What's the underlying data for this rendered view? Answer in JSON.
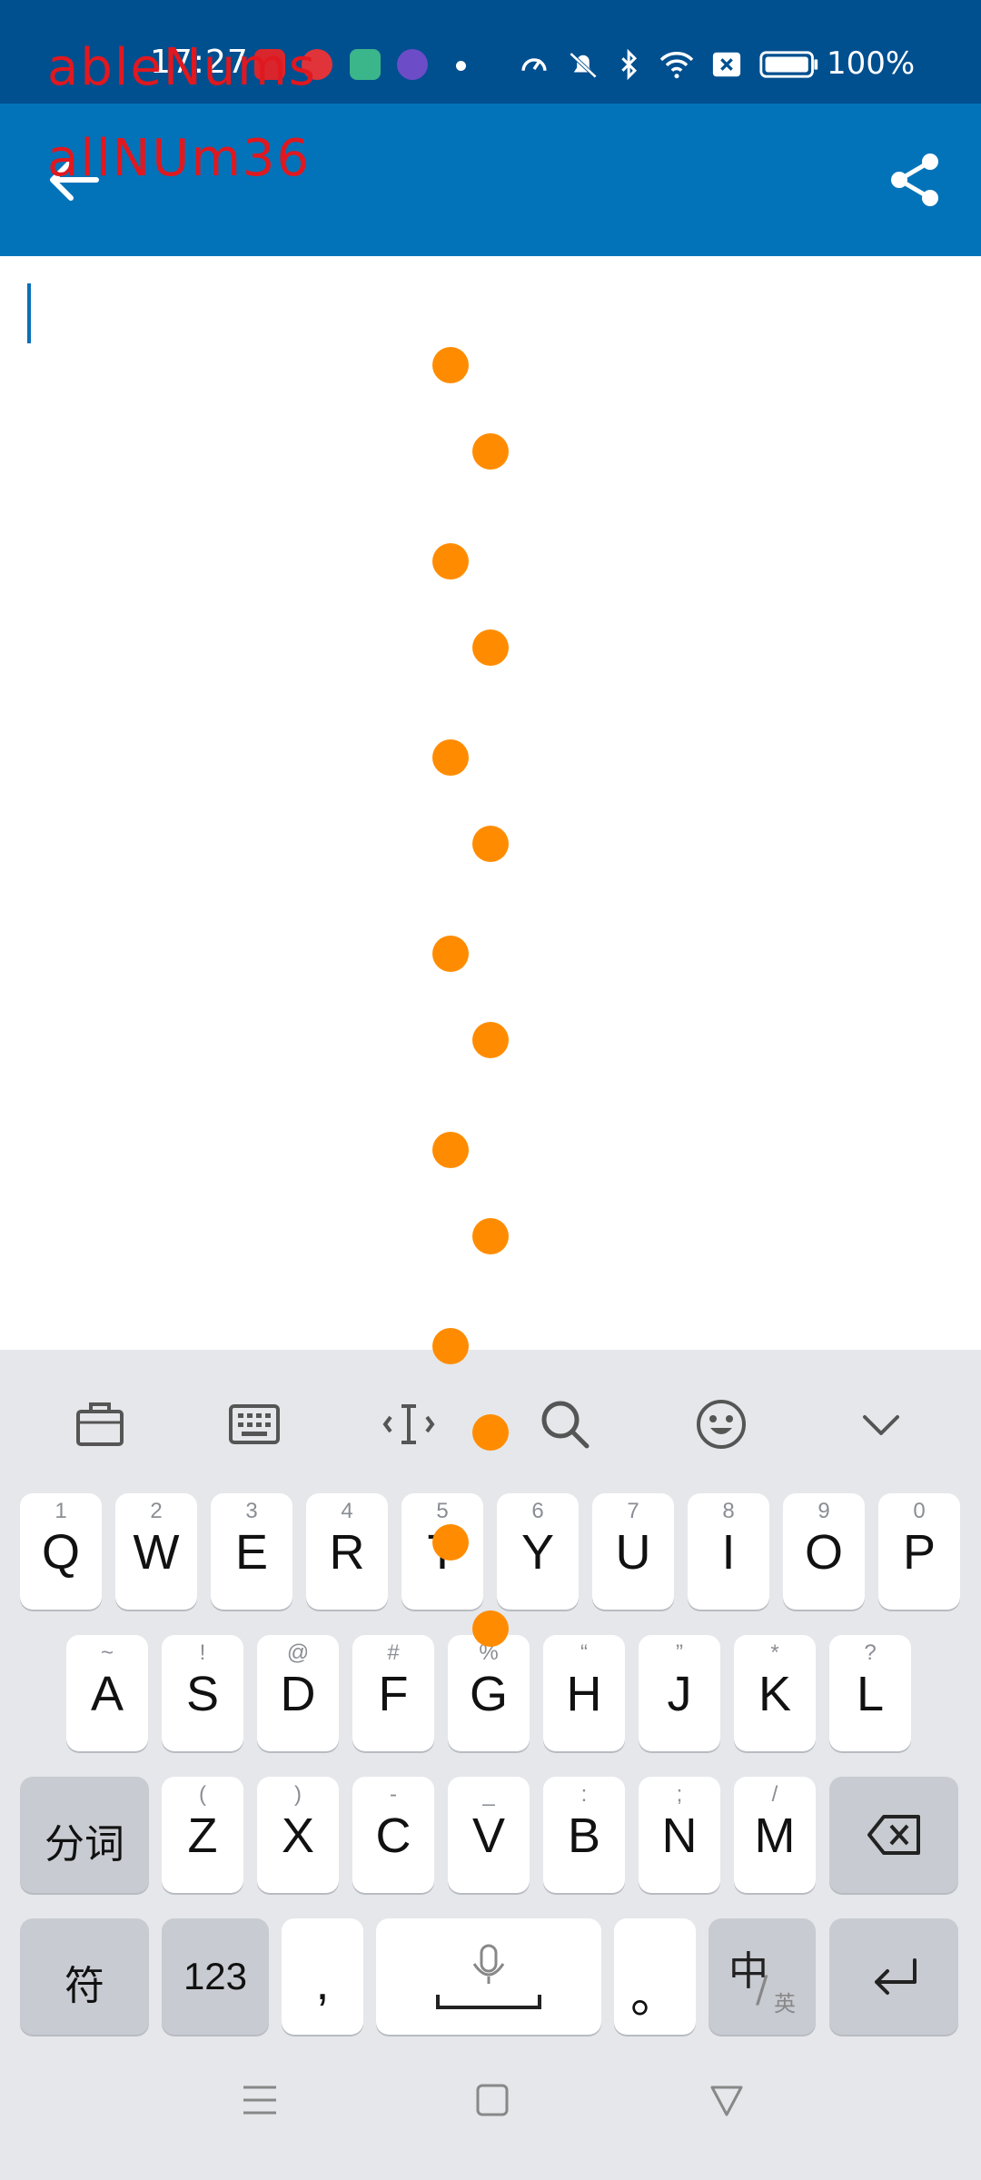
{
  "status_bar": {
    "time": "17:27",
    "battery": "100%"
  },
  "overlay": {
    "line1": "ableNums",
    "line2": "allNUm36"
  },
  "keyboard": {
    "row1": [
      {
        "label": "Q",
        "hint": "1"
      },
      {
        "label": "W",
        "hint": "2"
      },
      {
        "label": "E",
        "hint": "3"
      },
      {
        "label": "R",
        "hint": "4"
      },
      {
        "label": "T",
        "hint": "5"
      },
      {
        "label": "Y",
        "hint": "6"
      },
      {
        "label": "U",
        "hint": "7"
      },
      {
        "label": "I",
        "hint": "8"
      },
      {
        "label": "O",
        "hint": "9"
      },
      {
        "label": "P",
        "hint": "0"
      }
    ],
    "row2": [
      {
        "label": "A",
        "hint": "~"
      },
      {
        "label": "S",
        "hint": "!"
      },
      {
        "label": "D",
        "hint": "@"
      },
      {
        "label": "F",
        "hint": "#"
      },
      {
        "label": "G",
        "hint": "%"
      },
      {
        "label": "H",
        "hint": "“"
      },
      {
        "label": "J",
        "hint": "”"
      },
      {
        "label": "K",
        "hint": "*"
      },
      {
        "label": "L",
        "hint": "?"
      }
    ],
    "row3": [
      {
        "label": "Z",
        "hint": "("
      },
      {
        "label": "X",
        "hint": ")"
      },
      {
        "label": "C",
        "hint": "-"
      },
      {
        "label": "V",
        "hint": "_"
      },
      {
        "label": "B",
        "hint": ":"
      },
      {
        "label": "N",
        "hint": ";"
      },
      {
        "label": "M",
        "hint": "/"
      }
    ],
    "fenci": "分词",
    "fu": "符",
    "num": "123",
    "comma": ",",
    "period": "。",
    "zhong": "中",
    "ying": "英"
  },
  "colors": {
    "status_bar": "#004f8f",
    "app_bar": "#0273b9",
    "dot": "#ff8c00",
    "overlay_text": "#e0181f",
    "keyboard_bg": "#e5e7ea"
  },
  "icons": {
    "back": "arrow-left-icon",
    "share": "share-icon",
    "toolbar": [
      "briefcase-icon",
      "keyboard-icon",
      "text-cursor-icon",
      "search-icon",
      "emoji-icon",
      "chevron-down-icon"
    ],
    "nav": [
      "menu-icon",
      "home-icon",
      "back-triangle-icon"
    ]
  }
}
